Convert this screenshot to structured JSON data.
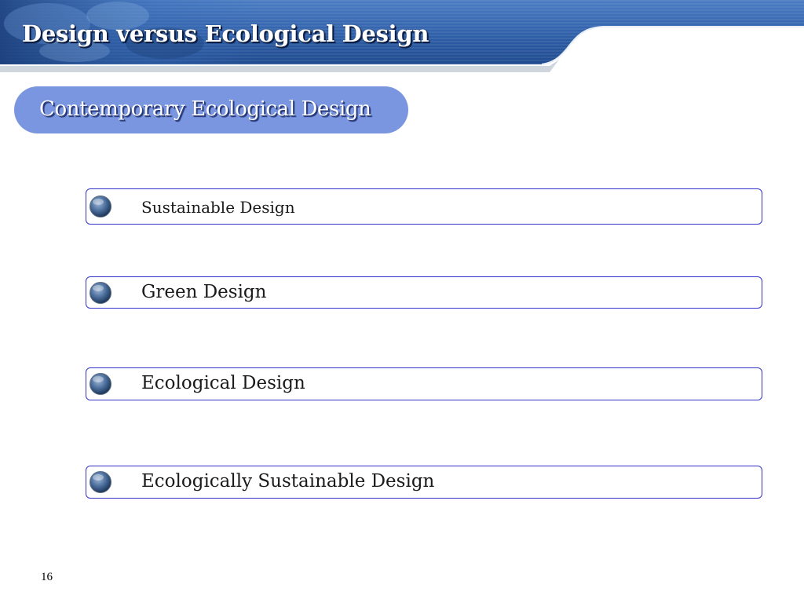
{
  "slide": {
    "title": "Design versus Ecological Design",
    "section_title": "Contemporary Ecological Design",
    "items": [
      {
        "label": "Sustainable Design"
      },
      {
        "label": "Green Design"
      },
      {
        "label": "Ecological Design"
      },
      {
        "label": "Ecologically Sustainable Design"
      }
    ],
    "page_number": "16"
  },
  "colors": {
    "banner_blue": "#2f5fa8",
    "pill_fill": "#7b96e0",
    "item_border": "#3333cc"
  },
  "icons": {
    "bullet": "glossy-blue-sphere-icon"
  }
}
